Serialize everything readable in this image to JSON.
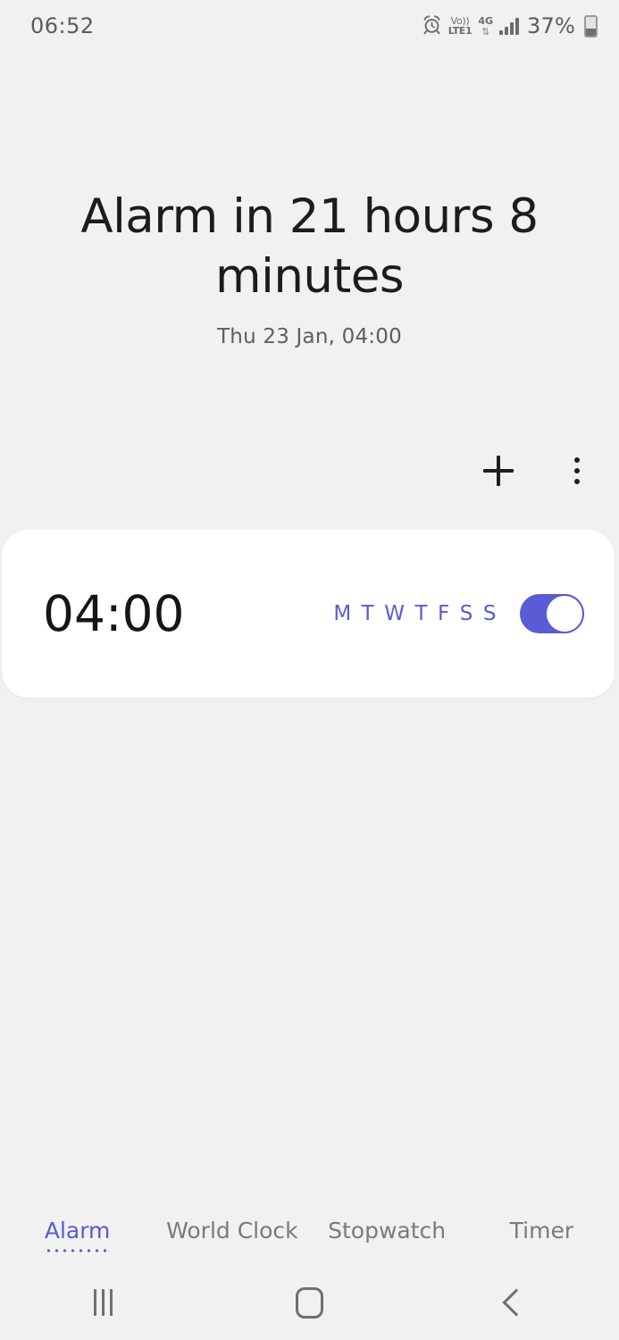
{
  "status_bar": {
    "time": "06:52",
    "alarm_icon": "alarm-clock-icon",
    "volte_top": "Vo))",
    "volte_bottom": "LTE1",
    "network_type": "4G",
    "network_arrows": "⇅",
    "signal_icon": "signal-bars-icon",
    "battery_percent": "37%",
    "battery_level": 37,
    "battery_icon": "battery-icon"
  },
  "header": {
    "headline": "Alarm in 21 hours 8 minutes",
    "subline": "Thu 23 Jan, 04:00"
  },
  "actions": {
    "add_label": "+",
    "add_icon": "plus-icon",
    "more_icon": "more-vertical-icon"
  },
  "alarm": {
    "time": "04:00",
    "days": [
      {
        "letter": "M",
        "selected": true
      },
      {
        "letter": "T",
        "selected": true
      },
      {
        "letter": "W",
        "selected": true
      },
      {
        "letter": "T",
        "selected": true
      },
      {
        "letter": "F",
        "selected": true
      },
      {
        "letter": "S",
        "selected": true
      },
      {
        "letter": "S",
        "selected": true
      }
    ],
    "enabled": true
  },
  "tabs": [
    {
      "label": "Alarm",
      "active": true
    },
    {
      "label": "World Clock",
      "active": false
    },
    {
      "label": "Stopwatch",
      "active": false
    },
    {
      "label": "Timer",
      "active": false
    }
  ],
  "nav_bar": {
    "recents_icon": "recents-icon",
    "home_icon": "home-icon",
    "back_icon": "back-icon"
  },
  "colors": {
    "accent": "#5b5bd6",
    "background": "#f1f1f1",
    "card": "#ffffff",
    "text_primary": "#1c1c1c",
    "text_secondary": "#5e5e5e",
    "text_muted": "#7a7a7a"
  }
}
